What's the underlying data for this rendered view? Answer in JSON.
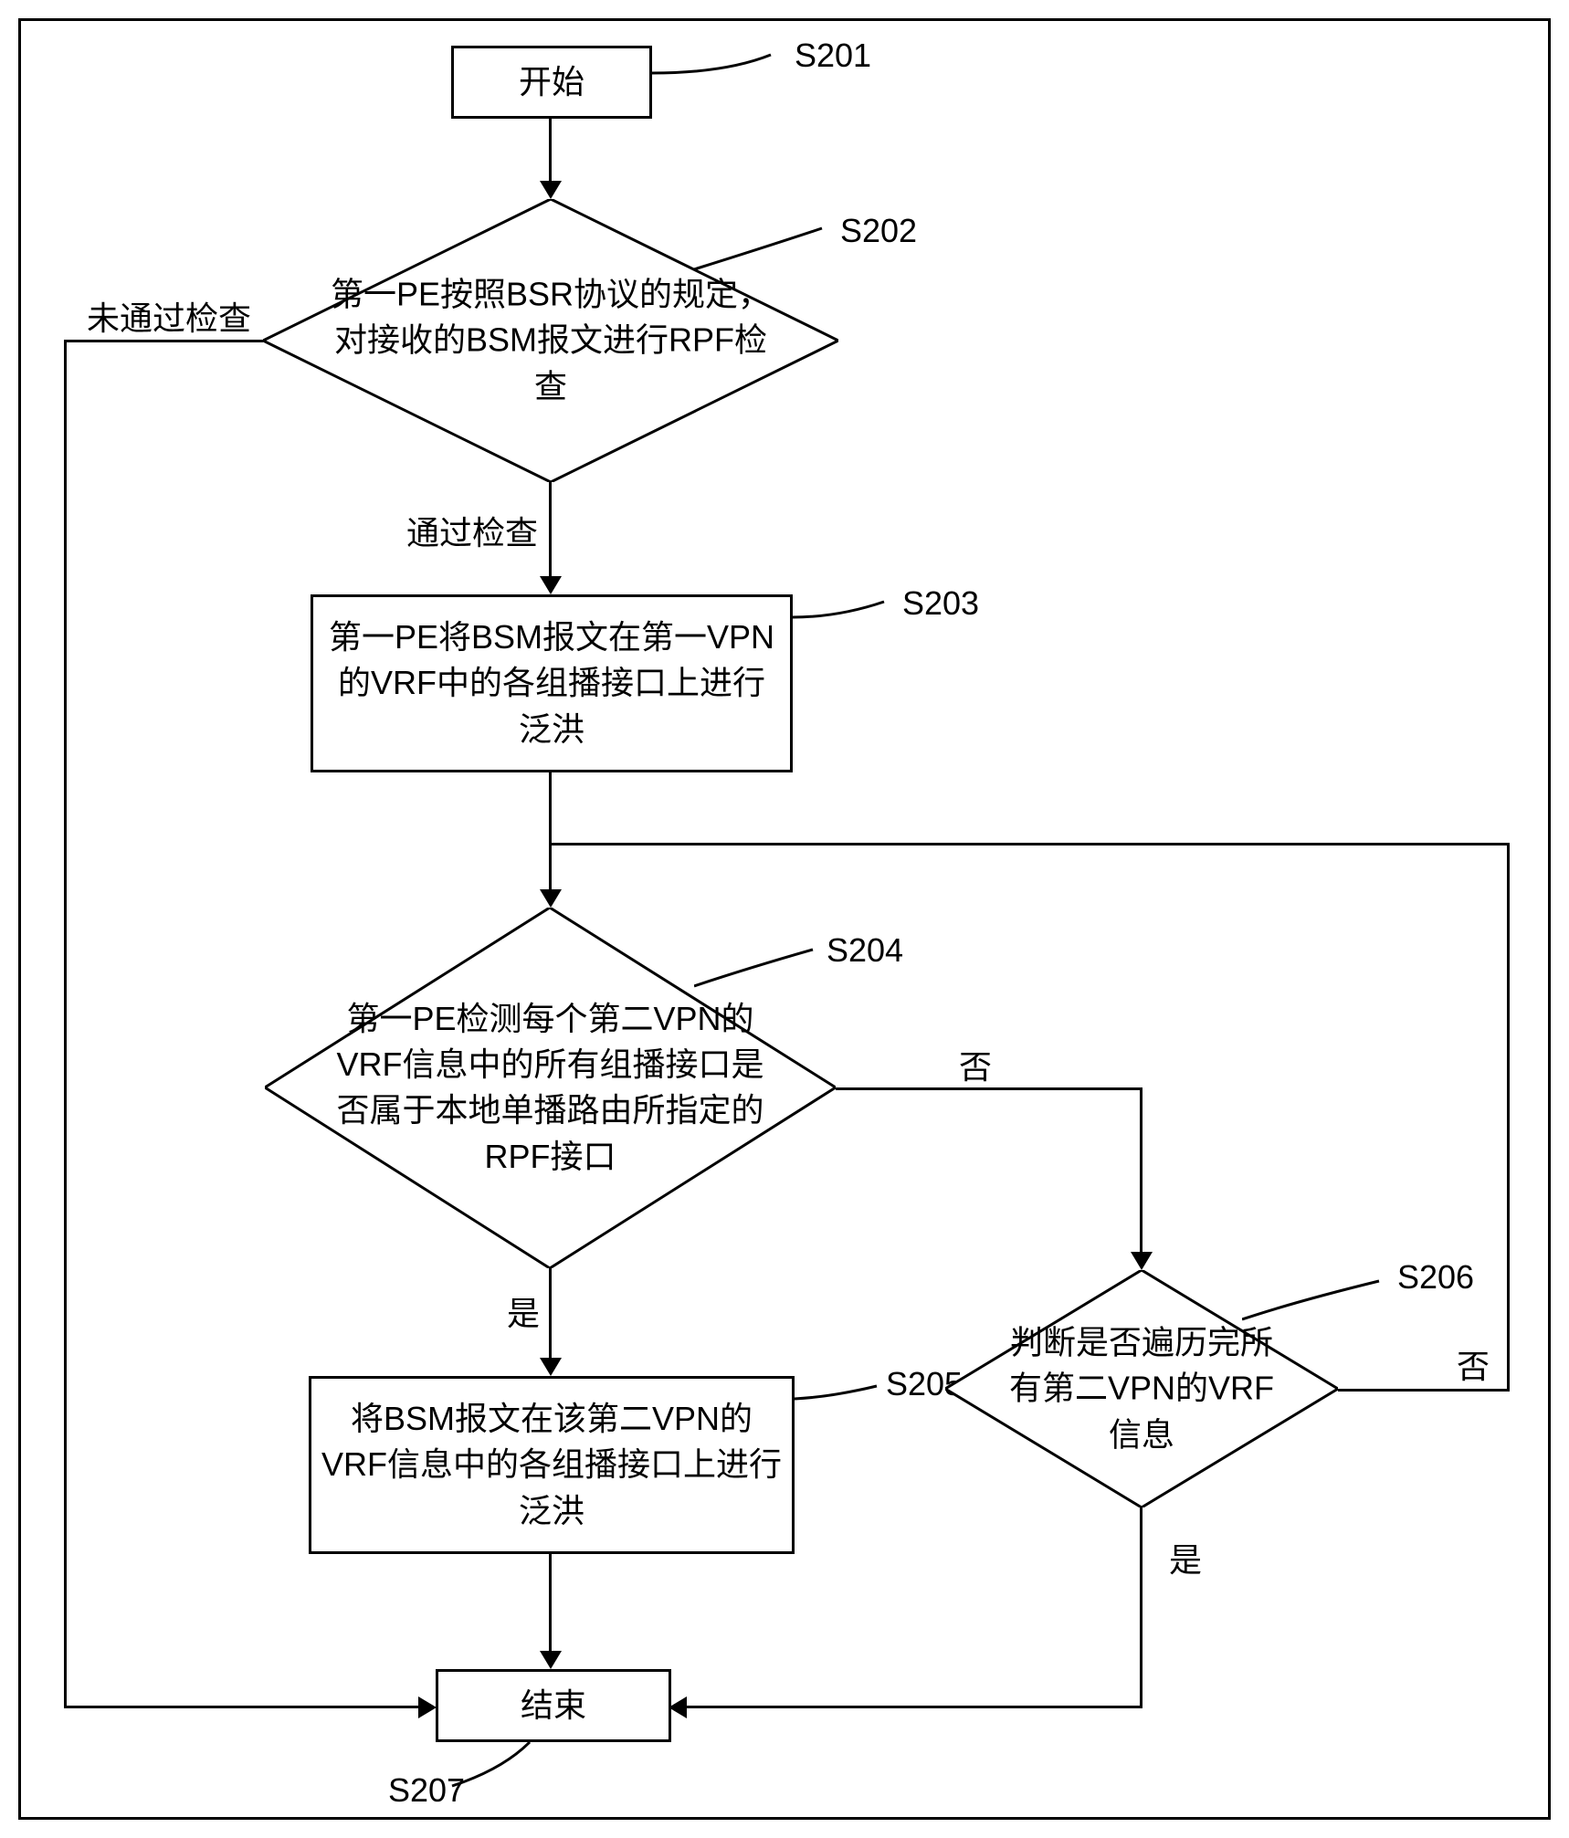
{
  "flowchart": {
    "nodes": {
      "start": {
        "text": "开始",
        "label": "S201"
      },
      "s202": {
        "text": "第一PE按照BSR协议的规定，对接收的BSM报文进行RPF检查",
        "label": "S202",
        "pass": "通过检查",
        "fail": "未通过检查"
      },
      "s203": {
        "text": "第一PE将BSM报文在第一VPN的VRF中的各组播接口上进行泛洪",
        "label": "S203"
      },
      "s204": {
        "text": "第一PE检测每个第二VPN的VRF信息中的所有组播接口是否属于本地单播路由所指定的RPF接口",
        "label": "S204",
        "yes": "是",
        "no": "否"
      },
      "s205": {
        "text": "将BSM报文在该第二VPN的VRF信息中的各组播接口上进行泛洪",
        "label": "S205"
      },
      "s206": {
        "text": "判断是否遍历完所有第二VPN的VRF信息",
        "label": "S206",
        "yes": "是",
        "no": "否"
      },
      "end": {
        "text": "结束",
        "label": "S207"
      }
    }
  }
}
